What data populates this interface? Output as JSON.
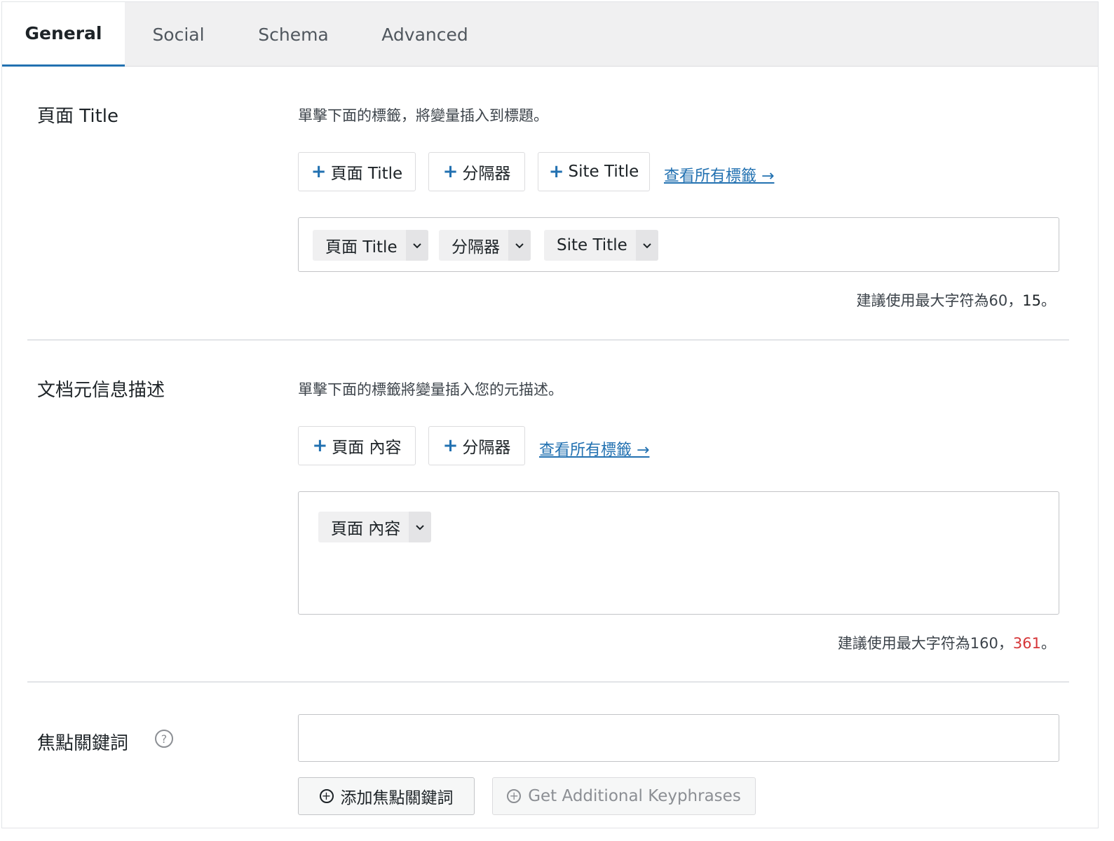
{
  "tabs": [
    {
      "label": "General",
      "active": true
    },
    {
      "label": "Social",
      "active": false
    },
    {
      "label": "Schema",
      "active": false
    },
    {
      "label": "Advanced",
      "active": false
    }
  ],
  "page_title": {
    "label": "頁面 Title",
    "description": "單擊下面的標籤，將變量插入到標題。",
    "tag_buttons": [
      "頁面 Title",
      "分隔器",
      "Site Title"
    ],
    "view_all_link": "查看所有標籤 →",
    "chips": [
      "頁面 Title",
      "分隔器",
      "Site Title"
    ],
    "counter_prefix": "建議使用最大字符為60，",
    "counter_value": "15",
    "counter_suffix": "。"
  },
  "meta_description": {
    "label": "文档元信息描述",
    "description": "單擊下面的標籤將變量插入您的元描述。",
    "tag_buttons": [
      "頁面 內容",
      "分隔器"
    ],
    "view_all_link": "查看所有標籤 →",
    "chips": [
      "頁面 內容"
    ],
    "counter_prefix": "建議使用最大字符為160，",
    "counter_value": "361",
    "counter_suffix": "。"
  },
  "focus_keyphrase": {
    "label": "焦點關鍵詞",
    "help_icon": "question-circle-icon",
    "input_value": "",
    "add_button": "添加焦點關鍵詞",
    "additional_button": "Get Additional Keyphrases"
  },
  "colors": {
    "accent": "#2271b1",
    "over_limit": "#d63638",
    "tab_bar": "#f0f0f1"
  }
}
